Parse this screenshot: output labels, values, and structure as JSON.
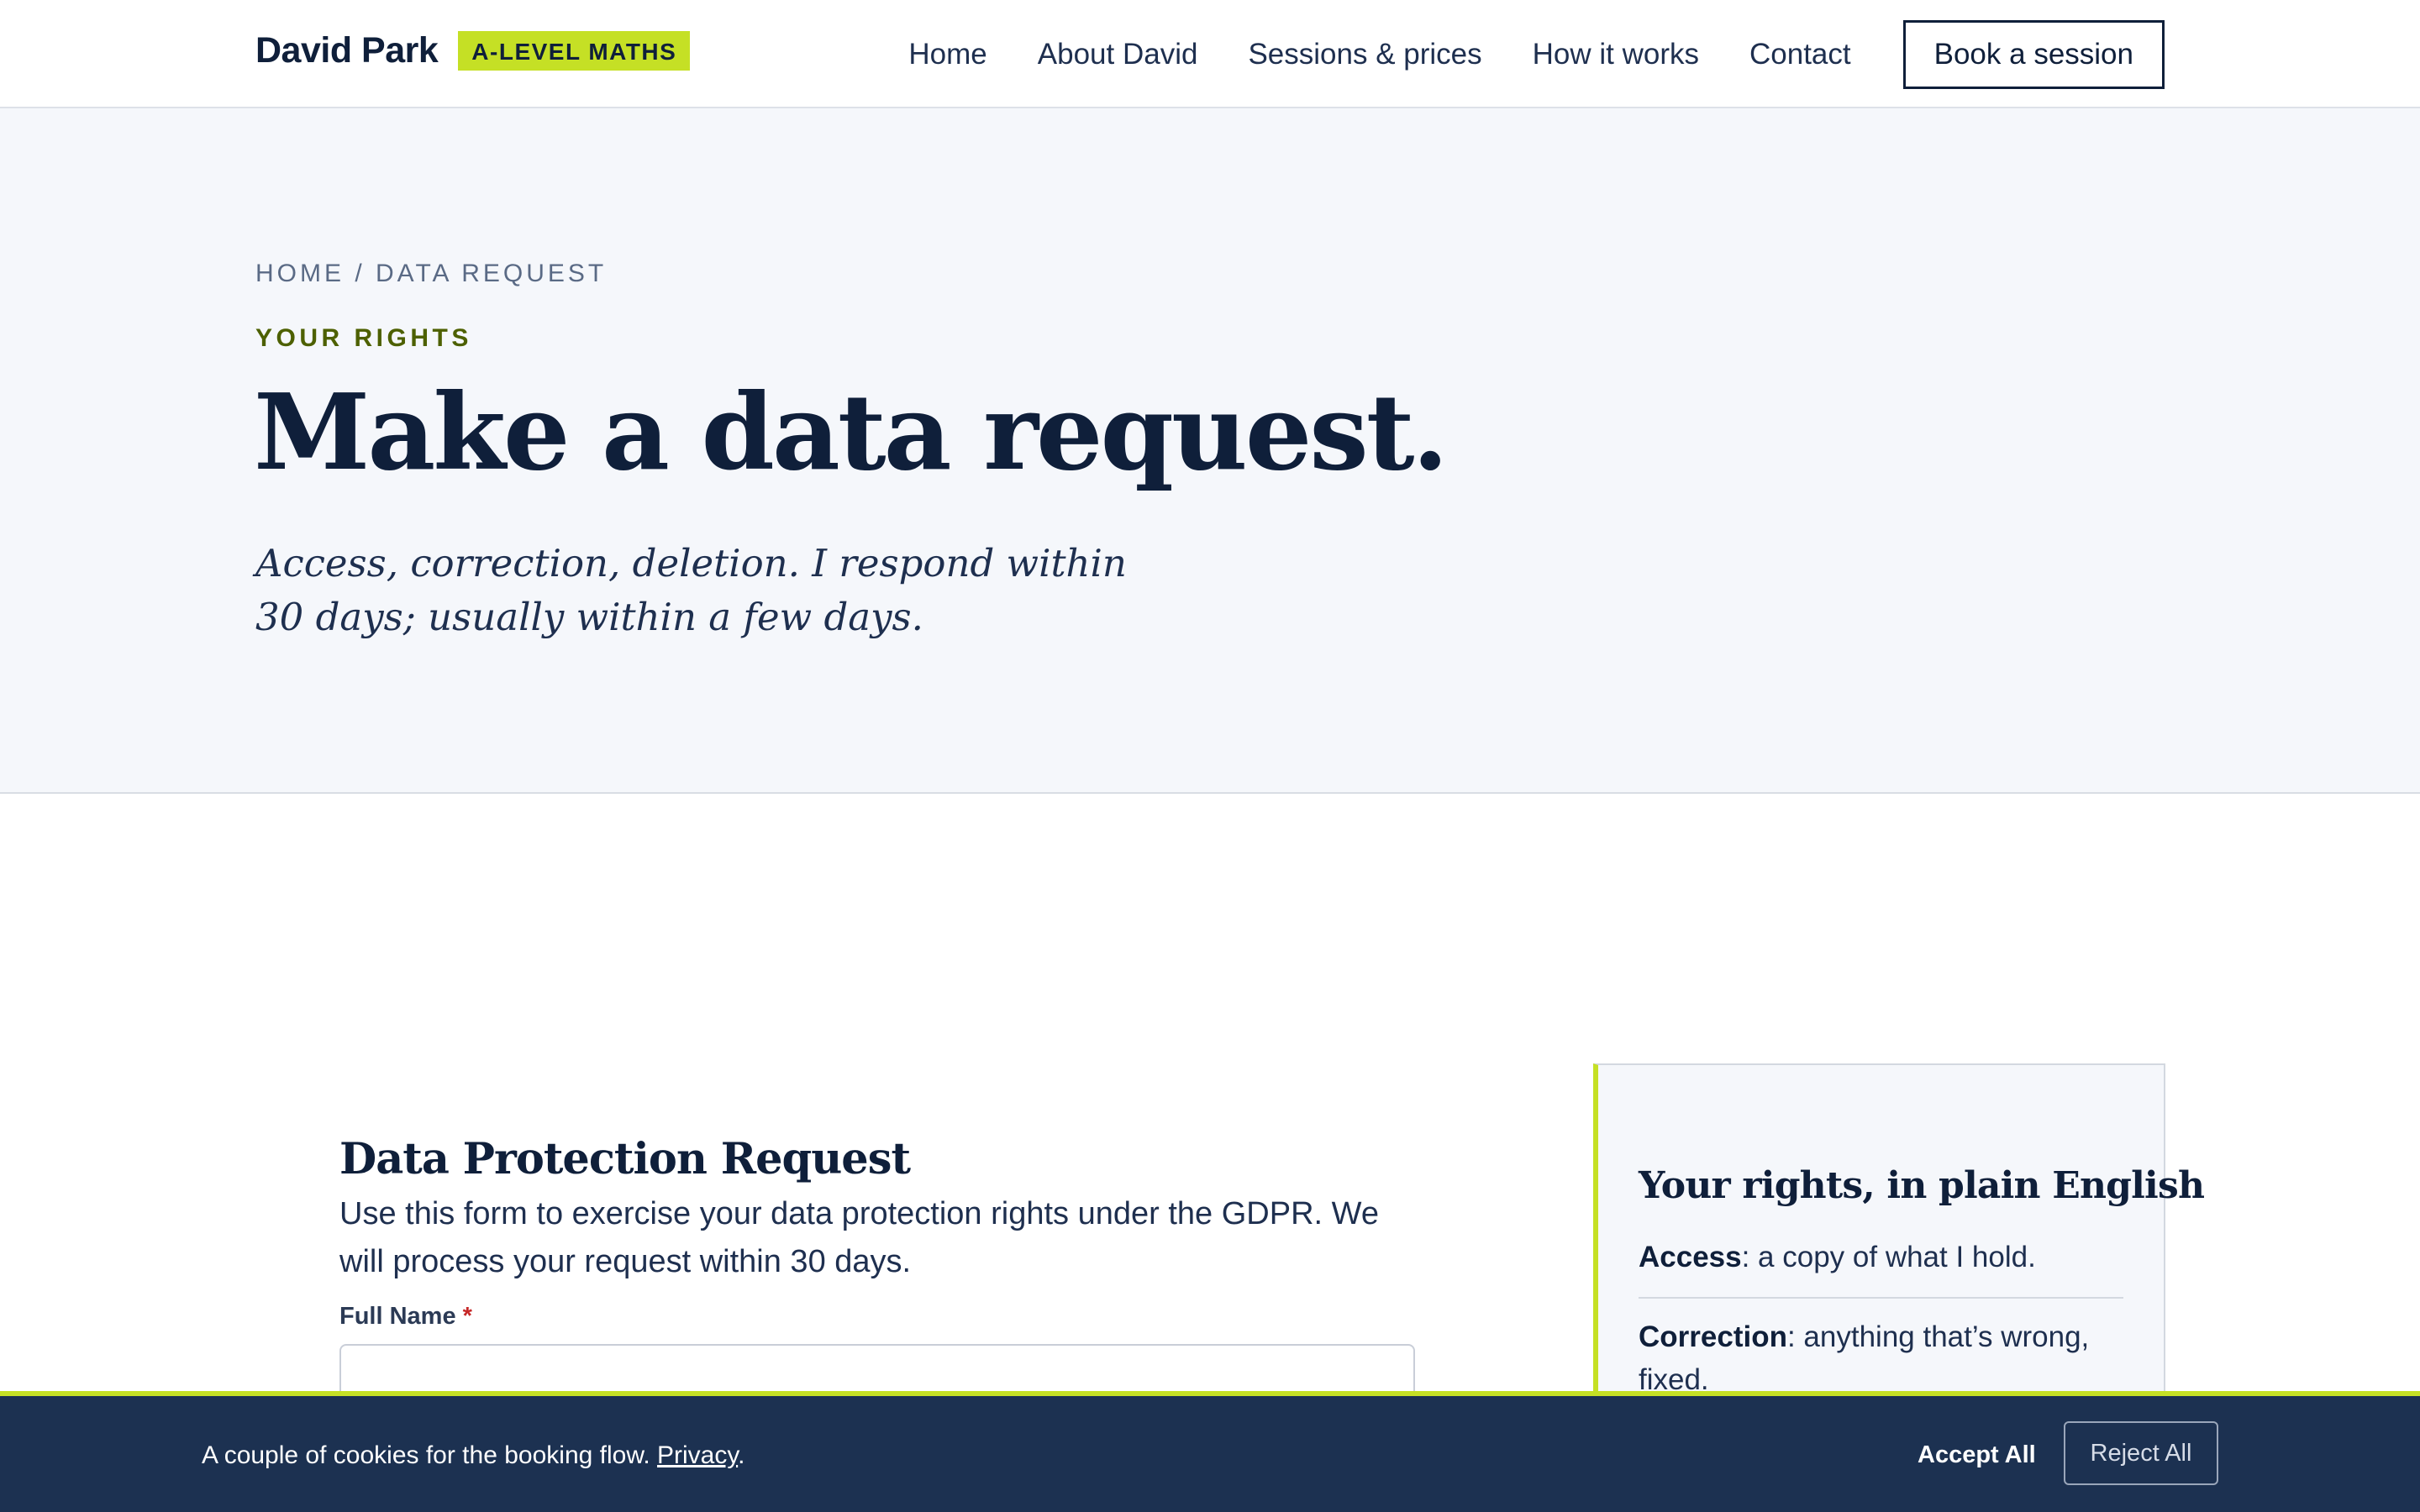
{
  "header": {
    "brand_name": "David Park",
    "brand_badge": "A-LEVEL MATHS",
    "nav": [
      {
        "label": "Home"
      },
      {
        "label": "About David"
      },
      {
        "label": "Sessions & prices"
      },
      {
        "label": "How it works"
      },
      {
        "label": "Contact"
      }
    ],
    "cta_label": "Book a session"
  },
  "hero": {
    "breadcrumb": "HOME / DATA REQUEST",
    "eyebrow": "YOUR RIGHTS",
    "title": "Make a data request.",
    "subtitle": "Access, correction, deletion. I respond within 30 days; usually within a few days."
  },
  "form": {
    "title": "Data Protection Request",
    "description": "Use this form to exercise your data protection rights under the GDPR. We will process your request within 30 days.",
    "fields": [
      {
        "label": "Full Name",
        "required_mark": "*",
        "value": "",
        "placeholder": ""
      }
    ]
  },
  "rights": {
    "title": "Your rights, in plain English",
    "items": [
      {
        "term": "Access",
        "desc": ": a copy of what I hold."
      },
      {
        "term": "Correction",
        "desc": ": anything that’s wrong, fixed."
      }
    ]
  },
  "cookie": {
    "text": "A couple of cookies for the booking flow. ",
    "link": "Privacy",
    "after_link": ".",
    "accept_label": "Accept All",
    "reject_label": "Reject All"
  },
  "colors": {
    "navy": "#0f1f3a",
    "accent_lime": "#c5e025",
    "hero_bg": "#f5f7fb",
    "banner_bg": "#1c3151",
    "required": "#c62828"
  }
}
